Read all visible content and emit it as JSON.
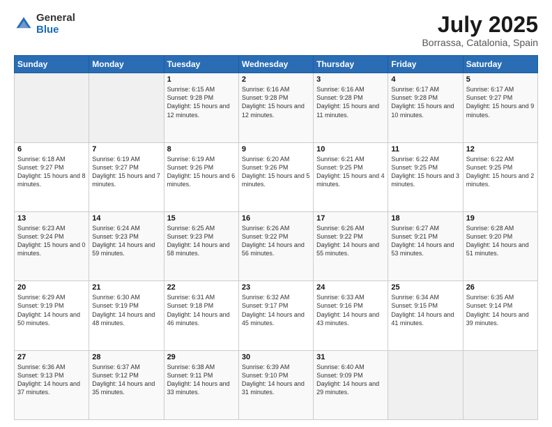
{
  "logo": {
    "general": "General",
    "blue": "Blue"
  },
  "title": "July 2025",
  "location": "Borrassa, Catalonia, Spain",
  "days_of_week": [
    "Sunday",
    "Monday",
    "Tuesday",
    "Wednesday",
    "Thursday",
    "Friday",
    "Saturday"
  ],
  "weeks": [
    [
      {
        "day": "",
        "sunrise": "",
        "sunset": "",
        "daylight": ""
      },
      {
        "day": "",
        "sunrise": "",
        "sunset": "",
        "daylight": ""
      },
      {
        "day": "1",
        "sunrise": "Sunrise: 6:15 AM",
        "sunset": "Sunset: 9:28 PM",
        "daylight": "Daylight: 15 hours and 12 minutes."
      },
      {
        "day": "2",
        "sunrise": "Sunrise: 6:16 AM",
        "sunset": "Sunset: 9:28 PM",
        "daylight": "Daylight: 15 hours and 12 minutes."
      },
      {
        "day": "3",
        "sunrise": "Sunrise: 6:16 AM",
        "sunset": "Sunset: 9:28 PM",
        "daylight": "Daylight: 15 hours and 11 minutes."
      },
      {
        "day": "4",
        "sunrise": "Sunrise: 6:17 AM",
        "sunset": "Sunset: 9:28 PM",
        "daylight": "Daylight: 15 hours and 10 minutes."
      },
      {
        "day": "5",
        "sunrise": "Sunrise: 6:17 AM",
        "sunset": "Sunset: 9:27 PM",
        "daylight": "Daylight: 15 hours and 9 minutes."
      }
    ],
    [
      {
        "day": "6",
        "sunrise": "Sunrise: 6:18 AM",
        "sunset": "Sunset: 9:27 PM",
        "daylight": "Daylight: 15 hours and 8 minutes."
      },
      {
        "day": "7",
        "sunrise": "Sunrise: 6:19 AM",
        "sunset": "Sunset: 9:27 PM",
        "daylight": "Daylight: 15 hours and 7 minutes."
      },
      {
        "day": "8",
        "sunrise": "Sunrise: 6:19 AM",
        "sunset": "Sunset: 9:26 PM",
        "daylight": "Daylight: 15 hours and 6 minutes."
      },
      {
        "day": "9",
        "sunrise": "Sunrise: 6:20 AM",
        "sunset": "Sunset: 9:26 PM",
        "daylight": "Daylight: 15 hours and 5 minutes."
      },
      {
        "day": "10",
        "sunrise": "Sunrise: 6:21 AM",
        "sunset": "Sunset: 9:25 PM",
        "daylight": "Daylight: 15 hours and 4 minutes."
      },
      {
        "day": "11",
        "sunrise": "Sunrise: 6:22 AM",
        "sunset": "Sunset: 9:25 PM",
        "daylight": "Daylight: 15 hours and 3 minutes."
      },
      {
        "day": "12",
        "sunrise": "Sunrise: 6:22 AM",
        "sunset": "Sunset: 9:25 PM",
        "daylight": "Daylight: 15 hours and 2 minutes."
      }
    ],
    [
      {
        "day": "13",
        "sunrise": "Sunrise: 6:23 AM",
        "sunset": "Sunset: 9:24 PM",
        "daylight": "Daylight: 15 hours and 0 minutes."
      },
      {
        "day": "14",
        "sunrise": "Sunrise: 6:24 AM",
        "sunset": "Sunset: 9:23 PM",
        "daylight": "Daylight: 14 hours and 59 minutes."
      },
      {
        "day": "15",
        "sunrise": "Sunrise: 6:25 AM",
        "sunset": "Sunset: 9:23 PM",
        "daylight": "Daylight: 14 hours and 58 minutes."
      },
      {
        "day": "16",
        "sunrise": "Sunrise: 6:26 AM",
        "sunset": "Sunset: 9:22 PM",
        "daylight": "Daylight: 14 hours and 56 minutes."
      },
      {
        "day": "17",
        "sunrise": "Sunrise: 6:26 AM",
        "sunset": "Sunset: 9:22 PM",
        "daylight": "Daylight: 14 hours and 55 minutes."
      },
      {
        "day": "18",
        "sunrise": "Sunrise: 6:27 AM",
        "sunset": "Sunset: 9:21 PM",
        "daylight": "Daylight: 14 hours and 53 minutes."
      },
      {
        "day": "19",
        "sunrise": "Sunrise: 6:28 AM",
        "sunset": "Sunset: 9:20 PM",
        "daylight": "Daylight: 14 hours and 51 minutes."
      }
    ],
    [
      {
        "day": "20",
        "sunrise": "Sunrise: 6:29 AM",
        "sunset": "Sunset: 9:19 PM",
        "daylight": "Daylight: 14 hours and 50 minutes."
      },
      {
        "day": "21",
        "sunrise": "Sunrise: 6:30 AM",
        "sunset": "Sunset: 9:19 PM",
        "daylight": "Daylight: 14 hours and 48 minutes."
      },
      {
        "day": "22",
        "sunrise": "Sunrise: 6:31 AM",
        "sunset": "Sunset: 9:18 PM",
        "daylight": "Daylight: 14 hours and 46 minutes."
      },
      {
        "day": "23",
        "sunrise": "Sunrise: 6:32 AM",
        "sunset": "Sunset: 9:17 PM",
        "daylight": "Daylight: 14 hours and 45 minutes."
      },
      {
        "day": "24",
        "sunrise": "Sunrise: 6:33 AM",
        "sunset": "Sunset: 9:16 PM",
        "daylight": "Daylight: 14 hours and 43 minutes."
      },
      {
        "day": "25",
        "sunrise": "Sunrise: 6:34 AM",
        "sunset": "Sunset: 9:15 PM",
        "daylight": "Daylight: 14 hours and 41 minutes."
      },
      {
        "day": "26",
        "sunrise": "Sunrise: 6:35 AM",
        "sunset": "Sunset: 9:14 PM",
        "daylight": "Daylight: 14 hours and 39 minutes."
      }
    ],
    [
      {
        "day": "27",
        "sunrise": "Sunrise: 6:36 AM",
        "sunset": "Sunset: 9:13 PM",
        "daylight": "Daylight: 14 hours and 37 minutes."
      },
      {
        "day": "28",
        "sunrise": "Sunrise: 6:37 AM",
        "sunset": "Sunset: 9:12 PM",
        "daylight": "Daylight: 14 hours and 35 minutes."
      },
      {
        "day": "29",
        "sunrise": "Sunrise: 6:38 AM",
        "sunset": "Sunset: 9:11 PM",
        "daylight": "Daylight: 14 hours and 33 minutes."
      },
      {
        "day": "30",
        "sunrise": "Sunrise: 6:39 AM",
        "sunset": "Sunset: 9:10 PM",
        "daylight": "Daylight: 14 hours and 31 minutes."
      },
      {
        "day": "31",
        "sunrise": "Sunrise: 6:40 AM",
        "sunset": "Sunset: 9:09 PM",
        "daylight": "Daylight: 14 hours and 29 minutes."
      },
      {
        "day": "",
        "sunrise": "",
        "sunset": "",
        "daylight": ""
      },
      {
        "day": "",
        "sunrise": "",
        "sunset": "",
        "daylight": ""
      }
    ]
  ]
}
